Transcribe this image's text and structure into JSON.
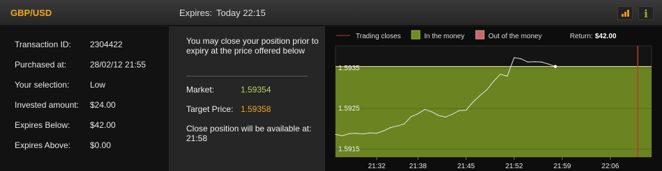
{
  "header": {
    "pair": "GBP/USD",
    "expires_label": "Expires:",
    "expires_value": "Today 22:15",
    "icons": [
      "signal-bars-icon",
      "info-icon"
    ],
    "accent_color": "#f0a81c"
  },
  "details": [
    {
      "label": "Transaction ID:",
      "value": "2304422"
    },
    {
      "label": "Purchased at:",
      "value": "28/02/12 21:55"
    },
    {
      "label": "Your selection:",
      "value": "Low"
    },
    {
      "label": "Invested amount:",
      "value": "$24.00"
    },
    {
      "label": "Expires Below:",
      "value": "$42.00"
    },
    {
      "label": "Expires Above:",
      "value": "$0.00"
    }
  ],
  "close_panel": {
    "message": "You may close your position prior to expiry at the price offered below",
    "market_label": "Market:",
    "market_value": "1.59354",
    "target_label": "Target Price:",
    "target_value": "1.59358",
    "note": "Close position will be available at: 21:58"
  },
  "chart_data": {
    "type": "line",
    "legend": [
      {
        "label": "Trading closes",
        "color": "#c0392b"
      },
      {
        "label": "In the money",
        "color": "#6f8a22"
      },
      {
        "label": "Out of the money",
        "color": "#c46a6a"
      }
    ],
    "return_label": "Return:",
    "return_value": "$42.00",
    "y_ticks": [
      "1.5935",
      "1.5925",
      "1.5915"
    ],
    "x_ticks": [
      "21:32",
      "21:38",
      "21:45",
      "21:52",
      "21:59",
      "22:06"
    ],
    "ylim": [
      1.5913,
      1.59405
    ],
    "xlim": [
      "21:26",
      "22:12"
    ],
    "in_the_money_below": 1.59354,
    "trading_closes": "22:10",
    "series": [
      {
        "values": [
          [
            "21:26",
            1.59186
          ],
          [
            "21:27",
            1.59183
          ],
          [
            "21:28",
            1.59188
          ],
          [
            "21:29",
            1.59189
          ],
          [
            "21:30",
            1.59187
          ],
          [
            "21:31",
            1.5919
          ],
          [
            "21:32",
            1.59189
          ],
          [
            "21:33",
            1.59195
          ],
          [
            "21:34",
            1.59203
          ],
          [
            "21:35",
            1.59207
          ],
          [
            "21:36",
            1.59212
          ],
          [
            "21:37",
            1.5923
          ],
          [
            "21:38",
            1.59237
          ],
          [
            "21:39",
            1.59248
          ],
          [
            "21:40",
            1.59242
          ],
          [
            "21:41",
            1.59233
          ],
          [
            "21:42",
            1.59229
          ],
          [
            "21:43",
            1.59236
          ],
          [
            "21:44",
            1.59245
          ],
          [
            "21:45",
            1.59246
          ],
          [
            "21:46",
            1.59266
          ],
          [
            "21:47",
            1.59282
          ],
          [
            "21:48",
            1.59296
          ],
          [
            "21:49",
            1.59317
          ],
          [
            "21:50",
            1.59335
          ],
          [
            "21:51",
            1.5933
          ],
          [
            "21:52",
            1.59376
          ],
          [
            "21:53",
            1.59373
          ],
          [
            "21:54",
            1.59365
          ],
          [
            "21:55",
            1.59366
          ],
          [
            "21:56",
            1.59365
          ],
          [
            "21:57",
            1.5936
          ],
          [
            "21:58",
            1.59354
          ]
        ]
      }
    ],
    "colors": {
      "line": "#e6e6e6",
      "money_fill": "#6f8a22",
      "trading_close_line": "#c0392b"
    }
  }
}
